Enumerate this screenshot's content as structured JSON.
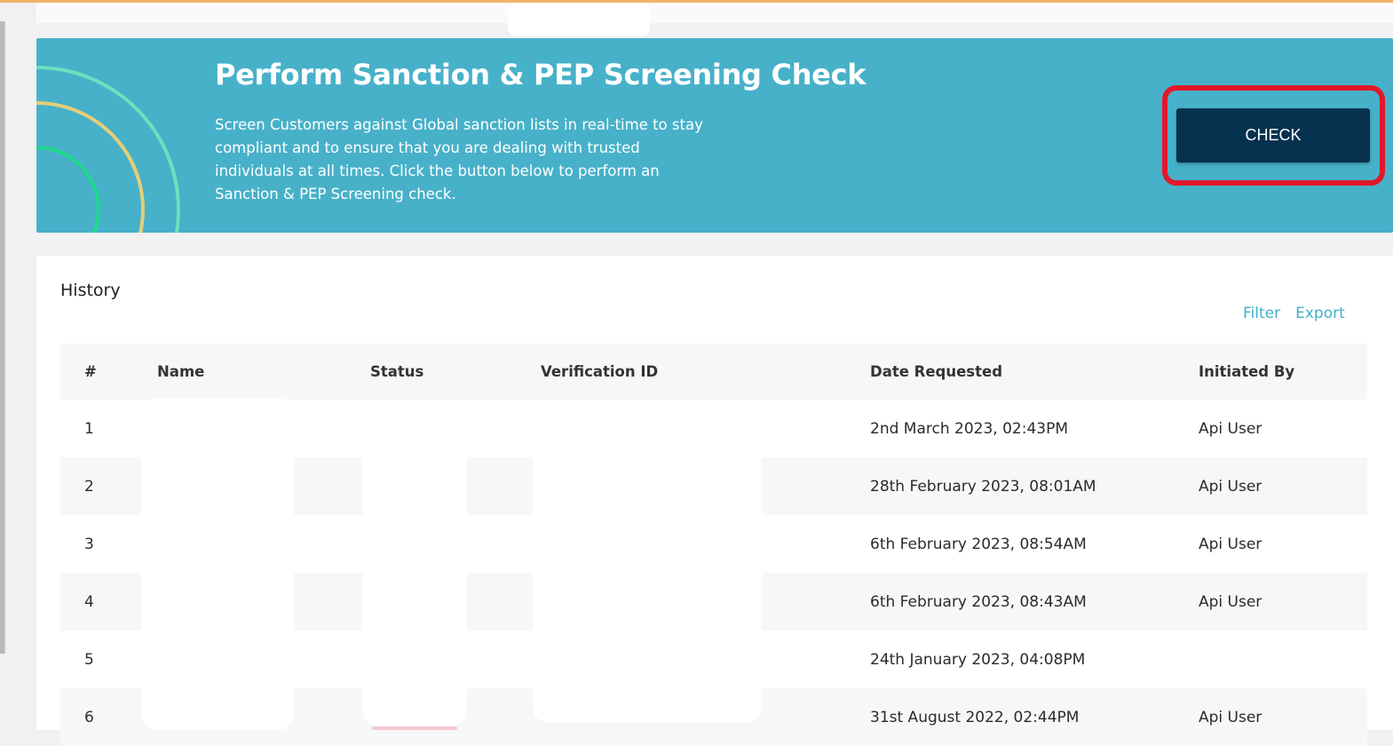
{
  "banner": {
    "title": "Perform Sanction & PEP Screening Check",
    "description": "Screen Customers against Global sanction lists in real-time to stay compliant and to ensure that you are dealing with trusted individuals at all times. Click the button below to perform an Sanction & PEP Screening check.",
    "check_label": "CHECK",
    "highlight_color": "#e3172a",
    "background_color": "#47b1c9",
    "button_color": "#06324f"
  },
  "history": {
    "title": "History",
    "filter_label": "Filter",
    "export_label": "Export",
    "accent_color": "#3fb1c9",
    "columns": [
      "#",
      "Name",
      "Status",
      "Verification ID",
      "Date Requested",
      "Initiated By"
    ],
    "rows": [
      {
        "num": "1",
        "date": "2nd March 2023, 02:43PM",
        "initiated_by": "Api User"
      },
      {
        "num": "2",
        "date": "28th February 2023, 08:01AM",
        "initiated_by": "Api User"
      },
      {
        "num": "3",
        "date": "6th February 2023, 08:54AM",
        "initiated_by": "Api User"
      },
      {
        "num": "4",
        "date": "6th February 2023, 08:43AM",
        "initiated_by": "Api User"
      },
      {
        "num": "5",
        "date": "24th January 2023, 04:08PM",
        "initiated_by": ""
      },
      {
        "num": "6",
        "date": "31st August 2022, 02:44PM",
        "initiated_by": "Api User"
      }
    ]
  }
}
